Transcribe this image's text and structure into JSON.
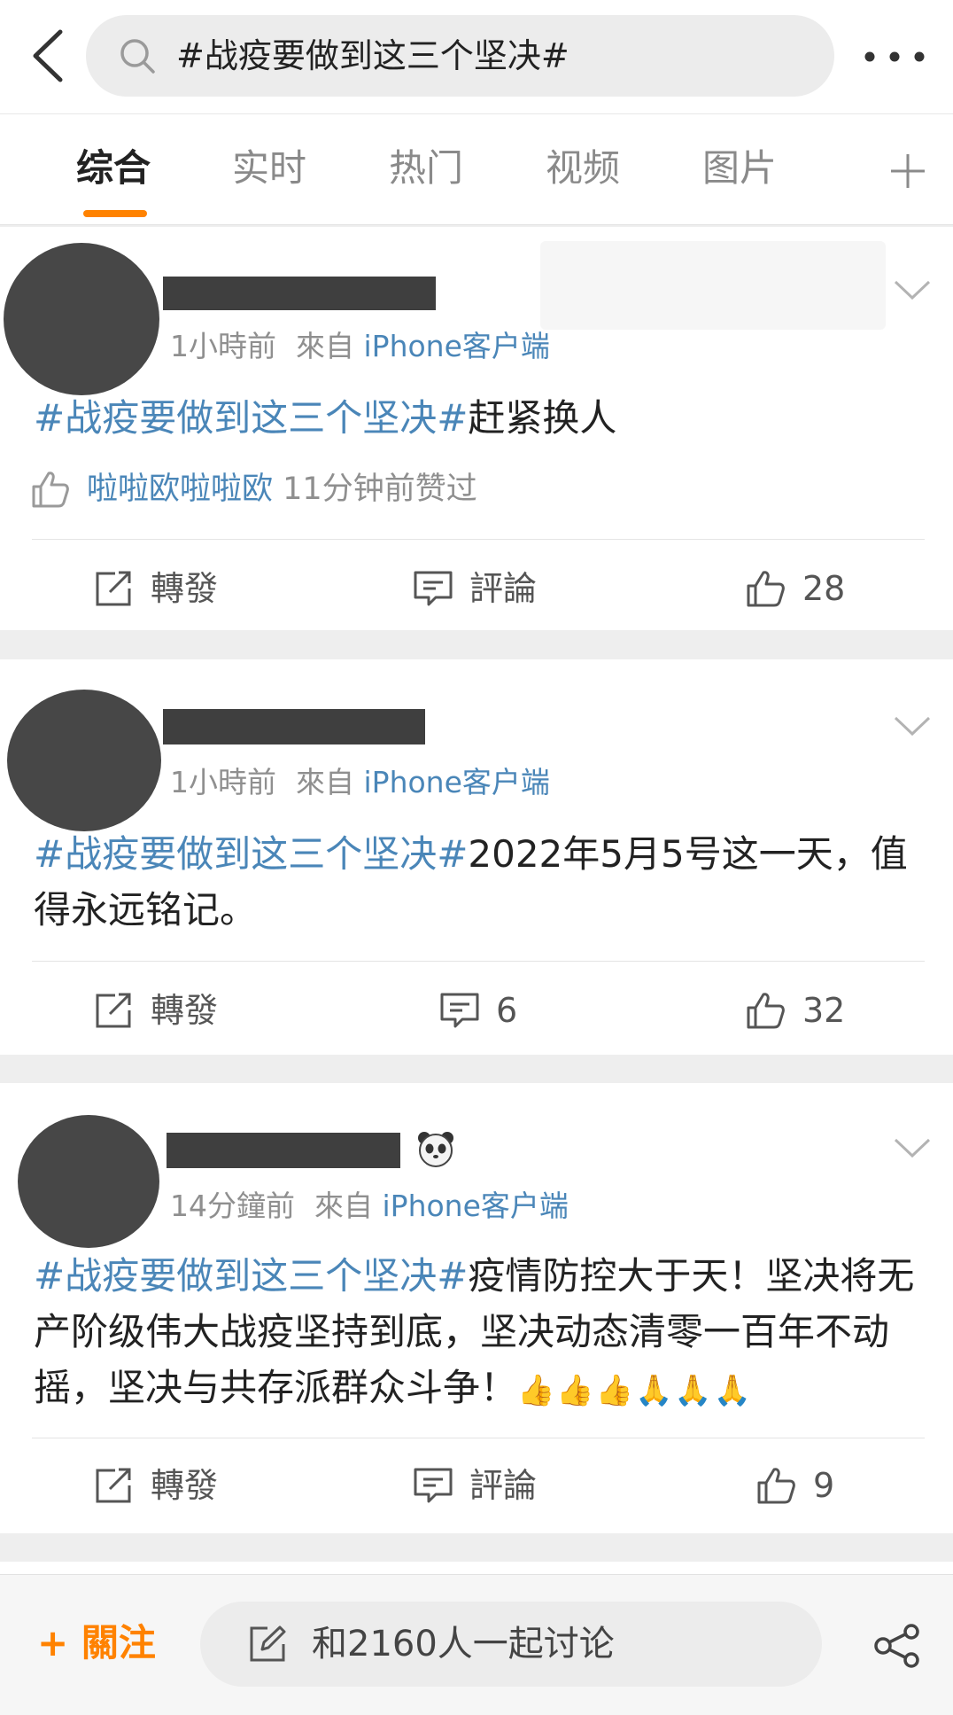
{
  "search": {
    "query": "#战疫要做到这三个坚决#"
  },
  "tabs": [
    {
      "label": "综合",
      "active": true
    },
    {
      "label": "实时"
    },
    {
      "label": "热门"
    },
    {
      "label": "视频"
    },
    {
      "label": "图片"
    }
  ],
  "posts": [
    {
      "time": "1小時前",
      "source_prefix": "來自",
      "source": "iPhone客户端",
      "hashtag": "#战疫要做到这三个坚决#",
      "body": "赶紧换人",
      "liked_by": {
        "user": "啦啦欧啦啦欧",
        "suffix": "11分钟前赞过"
      },
      "actions": {
        "repost": "轉發",
        "comment": "評論",
        "like": "28"
      }
    },
    {
      "time": "1小時前",
      "source_prefix": "來自",
      "source": "iPhone客户端",
      "hashtag": "#战疫要做到这三个坚决#",
      "body": "2022年5月5号这一天，值得永远铭记。",
      "actions": {
        "repost": "轉發",
        "comment": "6",
        "like": "32"
      }
    },
    {
      "time": "14分鐘前",
      "source_prefix": "來自",
      "source": "iPhone客户端",
      "hashtag": "#战疫要做到这三个坚决#",
      "body": "疫情防控大于天！坚决将无产阶级伟大战疫坚持到底，坚决动态清零一百年不动摇，坚决与共存派群众斗争！",
      "emojis": "👍👍👍🙏🙏🙏",
      "actions": {
        "repost": "轉發",
        "comment": "評論",
        "like": "9"
      }
    }
  ],
  "bottom": {
    "follow": "+ 關注",
    "discuss": "和2160人一起讨论"
  },
  "colors": {
    "accent": "#ff8200",
    "link": "#4a86b8"
  }
}
